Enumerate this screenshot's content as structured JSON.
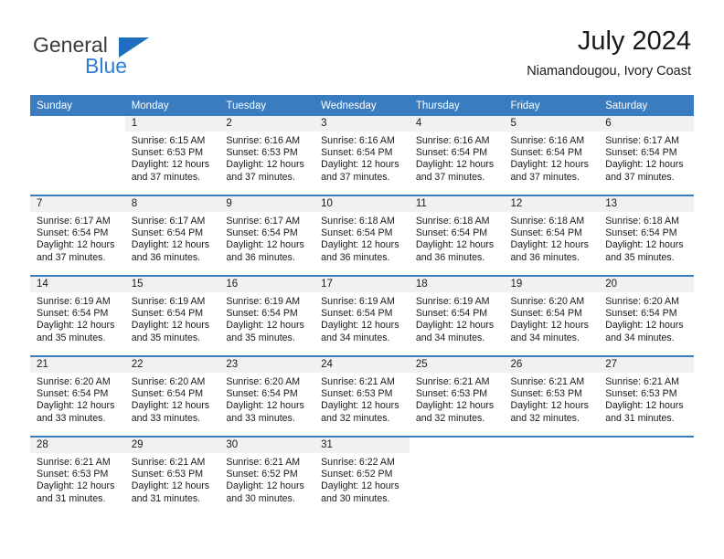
{
  "brand": {
    "name_top": "General",
    "name_bottom": "Blue",
    "triangle_color": "#1f6fc0",
    "blue_color": "#2a7fd4"
  },
  "header": {
    "title": "July 2024",
    "subtitle": "Niamandougou, Ivory Coast"
  },
  "theme": {
    "header_blue": "#3a7cc0",
    "daynum_band": "#f1f1f1",
    "text": "#1a1a1a"
  },
  "weekday_headers": [
    "Sunday",
    "Monday",
    "Tuesday",
    "Wednesday",
    "Thursday",
    "Friday",
    "Saturday"
  ],
  "weeks": [
    [
      {
        "day": "",
        "sunrise": "",
        "sunset": "",
        "daylight_line1": "",
        "daylight_line2": "",
        "blank": true
      },
      {
        "day": "1",
        "sunrise": "Sunrise: 6:15 AM",
        "sunset": "Sunset: 6:53 PM",
        "daylight_line1": "Daylight: 12 hours",
        "daylight_line2": "and 37 minutes."
      },
      {
        "day": "2",
        "sunrise": "Sunrise: 6:16 AM",
        "sunset": "Sunset: 6:53 PM",
        "daylight_line1": "Daylight: 12 hours",
        "daylight_line2": "and 37 minutes."
      },
      {
        "day": "3",
        "sunrise": "Sunrise: 6:16 AM",
        "sunset": "Sunset: 6:54 PM",
        "daylight_line1": "Daylight: 12 hours",
        "daylight_line2": "and 37 minutes."
      },
      {
        "day": "4",
        "sunrise": "Sunrise: 6:16 AM",
        "sunset": "Sunset: 6:54 PM",
        "daylight_line1": "Daylight: 12 hours",
        "daylight_line2": "and 37 minutes."
      },
      {
        "day": "5",
        "sunrise": "Sunrise: 6:16 AM",
        "sunset": "Sunset: 6:54 PM",
        "daylight_line1": "Daylight: 12 hours",
        "daylight_line2": "and 37 minutes."
      },
      {
        "day": "6",
        "sunrise": "Sunrise: 6:17 AM",
        "sunset": "Sunset: 6:54 PM",
        "daylight_line1": "Daylight: 12 hours",
        "daylight_line2": "and 37 minutes."
      }
    ],
    [
      {
        "day": "7",
        "sunrise": "Sunrise: 6:17 AM",
        "sunset": "Sunset: 6:54 PM",
        "daylight_line1": "Daylight: 12 hours",
        "daylight_line2": "and 37 minutes."
      },
      {
        "day": "8",
        "sunrise": "Sunrise: 6:17 AM",
        "sunset": "Sunset: 6:54 PM",
        "daylight_line1": "Daylight: 12 hours",
        "daylight_line2": "and 36 minutes."
      },
      {
        "day": "9",
        "sunrise": "Sunrise: 6:17 AM",
        "sunset": "Sunset: 6:54 PM",
        "daylight_line1": "Daylight: 12 hours",
        "daylight_line2": "and 36 minutes."
      },
      {
        "day": "10",
        "sunrise": "Sunrise: 6:18 AM",
        "sunset": "Sunset: 6:54 PM",
        "daylight_line1": "Daylight: 12 hours",
        "daylight_line2": "and 36 minutes."
      },
      {
        "day": "11",
        "sunrise": "Sunrise: 6:18 AM",
        "sunset": "Sunset: 6:54 PM",
        "daylight_line1": "Daylight: 12 hours",
        "daylight_line2": "and 36 minutes."
      },
      {
        "day": "12",
        "sunrise": "Sunrise: 6:18 AM",
        "sunset": "Sunset: 6:54 PM",
        "daylight_line1": "Daylight: 12 hours",
        "daylight_line2": "and 36 minutes."
      },
      {
        "day": "13",
        "sunrise": "Sunrise: 6:18 AM",
        "sunset": "Sunset: 6:54 PM",
        "daylight_line1": "Daylight: 12 hours",
        "daylight_line2": "and 35 minutes."
      }
    ],
    [
      {
        "day": "14",
        "sunrise": "Sunrise: 6:19 AM",
        "sunset": "Sunset: 6:54 PM",
        "daylight_line1": "Daylight: 12 hours",
        "daylight_line2": "and 35 minutes."
      },
      {
        "day": "15",
        "sunrise": "Sunrise: 6:19 AM",
        "sunset": "Sunset: 6:54 PM",
        "daylight_line1": "Daylight: 12 hours",
        "daylight_line2": "and 35 minutes."
      },
      {
        "day": "16",
        "sunrise": "Sunrise: 6:19 AM",
        "sunset": "Sunset: 6:54 PM",
        "daylight_line1": "Daylight: 12 hours",
        "daylight_line2": "and 35 minutes."
      },
      {
        "day": "17",
        "sunrise": "Sunrise: 6:19 AM",
        "sunset": "Sunset: 6:54 PM",
        "daylight_line1": "Daylight: 12 hours",
        "daylight_line2": "and 34 minutes."
      },
      {
        "day": "18",
        "sunrise": "Sunrise: 6:19 AM",
        "sunset": "Sunset: 6:54 PM",
        "daylight_line1": "Daylight: 12 hours",
        "daylight_line2": "and 34 minutes."
      },
      {
        "day": "19",
        "sunrise": "Sunrise: 6:20 AM",
        "sunset": "Sunset: 6:54 PM",
        "daylight_line1": "Daylight: 12 hours",
        "daylight_line2": "and 34 minutes."
      },
      {
        "day": "20",
        "sunrise": "Sunrise: 6:20 AM",
        "sunset": "Sunset: 6:54 PM",
        "daylight_line1": "Daylight: 12 hours",
        "daylight_line2": "and 34 minutes."
      }
    ],
    [
      {
        "day": "21",
        "sunrise": "Sunrise: 6:20 AM",
        "sunset": "Sunset: 6:54 PM",
        "daylight_line1": "Daylight: 12 hours",
        "daylight_line2": "and 33 minutes."
      },
      {
        "day": "22",
        "sunrise": "Sunrise: 6:20 AM",
        "sunset": "Sunset: 6:54 PM",
        "daylight_line1": "Daylight: 12 hours",
        "daylight_line2": "and 33 minutes."
      },
      {
        "day": "23",
        "sunrise": "Sunrise: 6:20 AM",
        "sunset": "Sunset: 6:54 PM",
        "daylight_line1": "Daylight: 12 hours",
        "daylight_line2": "and 33 minutes."
      },
      {
        "day": "24",
        "sunrise": "Sunrise: 6:21 AM",
        "sunset": "Sunset: 6:53 PM",
        "daylight_line1": "Daylight: 12 hours",
        "daylight_line2": "and 32 minutes."
      },
      {
        "day": "25",
        "sunrise": "Sunrise: 6:21 AM",
        "sunset": "Sunset: 6:53 PM",
        "daylight_line1": "Daylight: 12 hours",
        "daylight_line2": "and 32 minutes."
      },
      {
        "day": "26",
        "sunrise": "Sunrise: 6:21 AM",
        "sunset": "Sunset: 6:53 PM",
        "daylight_line1": "Daylight: 12 hours",
        "daylight_line2": "and 32 minutes."
      },
      {
        "day": "27",
        "sunrise": "Sunrise: 6:21 AM",
        "sunset": "Sunset: 6:53 PM",
        "daylight_line1": "Daylight: 12 hours",
        "daylight_line2": "and 31 minutes."
      }
    ],
    [
      {
        "day": "28",
        "sunrise": "Sunrise: 6:21 AM",
        "sunset": "Sunset: 6:53 PM",
        "daylight_line1": "Daylight: 12 hours",
        "daylight_line2": "and 31 minutes."
      },
      {
        "day": "29",
        "sunrise": "Sunrise: 6:21 AM",
        "sunset": "Sunset: 6:53 PM",
        "daylight_line1": "Daylight: 12 hours",
        "daylight_line2": "and 31 minutes."
      },
      {
        "day": "30",
        "sunrise": "Sunrise: 6:21 AM",
        "sunset": "Sunset: 6:52 PM",
        "daylight_line1": "Daylight: 12 hours",
        "daylight_line2": "and 30 minutes."
      },
      {
        "day": "31",
        "sunrise": "Sunrise: 6:22 AM",
        "sunset": "Sunset: 6:52 PM",
        "daylight_line1": "Daylight: 12 hours",
        "daylight_line2": "and 30 minutes."
      },
      {
        "day": "",
        "sunrise": "",
        "sunset": "",
        "daylight_line1": "",
        "daylight_line2": "",
        "blank": true
      },
      {
        "day": "",
        "sunrise": "",
        "sunset": "",
        "daylight_line1": "",
        "daylight_line2": "",
        "blank": true
      },
      {
        "day": "",
        "sunrise": "",
        "sunset": "",
        "daylight_line1": "",
        "daylight_line2": "",
        "blank": true
      }
    ]
  ]
}
